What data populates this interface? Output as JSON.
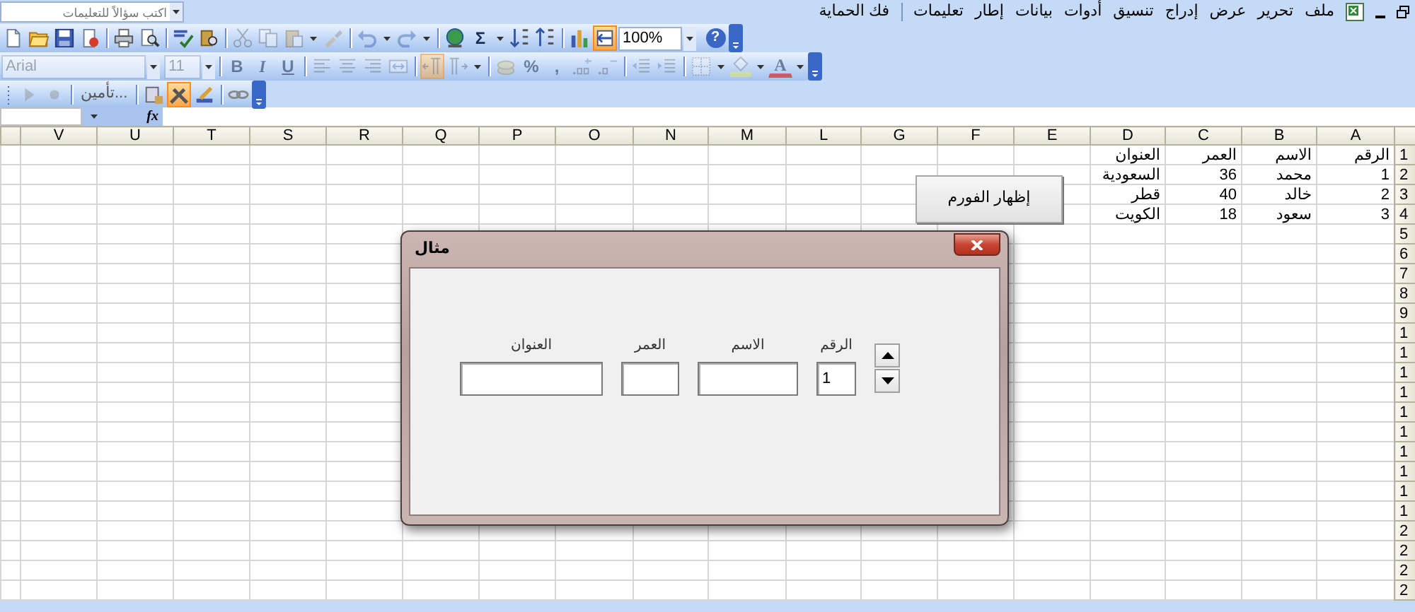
{
  "help_box": {
    "placeholder": "اكتب سؤالاً للتعليمات"
  },
  "menu": {
    "items": [
      "ملف",
      "تحرير",
      "عرض",
      "إدراج",
      "تنسيق",
      "أدوات",
      "بيانات",
      "إطار",
      "تعليمات"
    ],
    "protect_item": "فك الحماية"
  },
  "standard_toolbar": {
    "clipboard_disabled": true,
    "undo_disabled": true,
    "sum_symbol": "Σ",
    "right_to_left_pressed": true,
    "zoom": "100%",
    "help_symbol": "?"
  },
  "formatting_toolbar": {
    "disabled": true,
    "font": "Arial",
    "size": "11",
    "bold": "B",
    "italic": "I",
    "underline": "U",
    "paragraph_rtl_pressed": true,
    "percent": "%",
    "comma": ",",
    "font_color": "A"
  },
  "control_toolbar": {
    "macro_disabled": true,
    "protection_label": "تأمين...",
    "design_mode_pressed": true
  },
  "formula_bar": {
    "fx": "fx"
  },
  "sheet": {
    "columns": [
      "A",
      "B",
      "C",
      "D",
      "E",
      "F",
      "G",
      "L",
      "M",
      "N",
      "O",
      "P",
      "Q",
      "R",
      "S",
      "T",
      "U",
      "V"
    ],
    "row_numbers": [
      "1",
      "2",
      "3",
      "4",
      "5",
      "6",
      "7",
      "8",
      "9",
      "1",
      "1",
      "1",
      "1",
      "1",
      "1",
      "1",
      "1",
      "1",
      "1",
      "2",
      "2",
      "2",
      "2"
    ],
    "rows": [
      [
        "الرقم",
        "الاسم",
        "العمر",
        "العنوان"
      ],
      [
        "1",
        "محمد",
        "36",
        "السعودية"
      ],
      [
        "2",
        "خالد",
        "40",
        "قطر"
      ],
      [
        "3",
        "سعود",
        "18",
        "الكويت"
      ]
    ]
  },
  "sheet_button": {
    "label": "إظهار الفورم"
  },
  "dialog": {
    "title": "مثال",
    "fields": [
      {
        "label": "الرقم",
        "value": "1"
      },
      {
        "label": "الاسم"
      },
      {
        "label": "العمر"
      },
      {
        "label": "العنوان"
      }
    ]
  }
}
